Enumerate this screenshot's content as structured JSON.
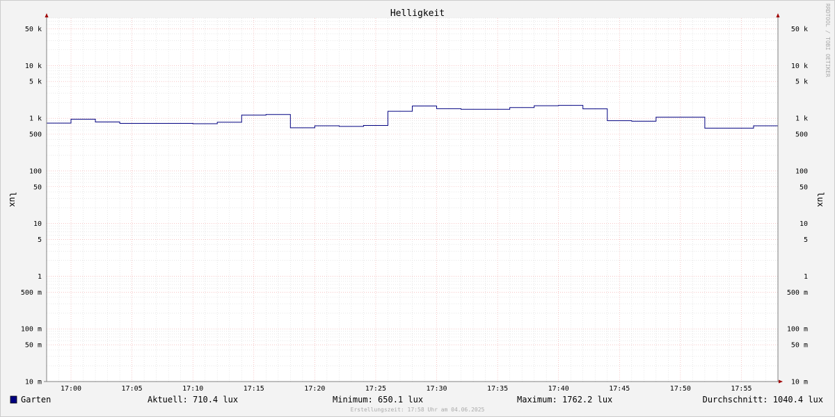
{
  "chart_data": {
    "type": "line",
    "title": "Helligkeit",
    "ylabel": "lux",
    "yscale": "log",
    "ylim": [
      0.01,
      80000
    ],
    "xlim": [
      "16:58",
      "17:58"
    ],
    "y_ticks": [
      {
        "value": 50000,
        "label": "50 k"
      },
      {
        "value": 10000,
        "label": "10 k"
      },
      {
        "value": 5000,
        "label": "5 k"
      },
      {
        "value": 1000,
        "label": "1 k"
      },
      {
        "value": 500,
        "label": "500"
      },
      {
        "value": 100,
        "label": "100"
      },
      {
        "value": 50,
        "label": "50"
      },
      {
        "value": 10,
        "label": "10"
      },
      {
        "value": 5,
        "label": "5"
      },
      {
        "value": 1,
        "label": "1"
      },
      {
        "value": 0.5,
        "label": "500 m"
      },
      {
        "value": 0.1,
        "label": "100 m"
      },
      {
        "value": 0.05,
        "label": "50 m"
      },
      {
        "value": 0.01,
        "label": "10 m"
      }
    ],
    "x_ticks": [
      "17:00",
      "17:05",
      "17:10",
      "17:15",
      "17:20",
      "17:25",
      "17:30",
      "17:35",
      "17:40",
      "17:45",
      "17:50",
      "17:55"
    ],
    "grid": true,
    "series": [
      {
        "name": "Garten",
        "color": "#000080",
        "step": true,
        "x": [
          "16:58",
          "17:00",
          "17:02",
          "17:04",
          "17:06",
          "17:08",
          "17:10",
          "17:12",
          "17:14",
          "17:16",
          "17:18",
          "17:20",
          "17:22",
          "17:24",
          "17:26",
          "17:28",
          "17:30",
          "17:32",
          "17:34",
          "17:36",
          "17:38",
          "17:40",
          "17:42",
          "17:44",
          "17:46",
          "17:48",
          "17:50",
          "17:52",
          "17:54",
          "17:56"
        ],
        "y": [
          810,
          960,
          850,
          800,
          800,
          800,
          790,
          840,
          1150,
          1180,
          660,
          720,
          700,
          730,
          1360,
          1710,
          1520,
          1480,
          1480,
          1600,
          1730,
          1760,
          1510,
          900,
          880,
          1050,
          1050,
          650,
          650,
          720
        ]
      }
    ],
    "legend": {
      "placement": "bottom-left",
      "series_name": "Garten"
    },
    "stats": {
      "current": "Aktuell: 710.4 lux",
      "minimum": "Minimum: 650.1 lux",
      "maximum": "Maximum: 1762.2 lux",
      "average": "Durchschnitt: 1040.4 lux"
    },
    "watermark": "RRDTOOL / TOBI OETIKER",
    "footer": "Erstellungszeit: 17:58 Uhr am 04.06.2025"
  },
  "colors": {
    "background": "#f3f3f3",
    "canvas": "#ffffff",
    "line": "#000080",
    "major_grid": "#f0a0a0",
    "minor_grid": "#d8d8d8",
    "axis": "#808080",
    "arrow": "#a00000"
  }
}
